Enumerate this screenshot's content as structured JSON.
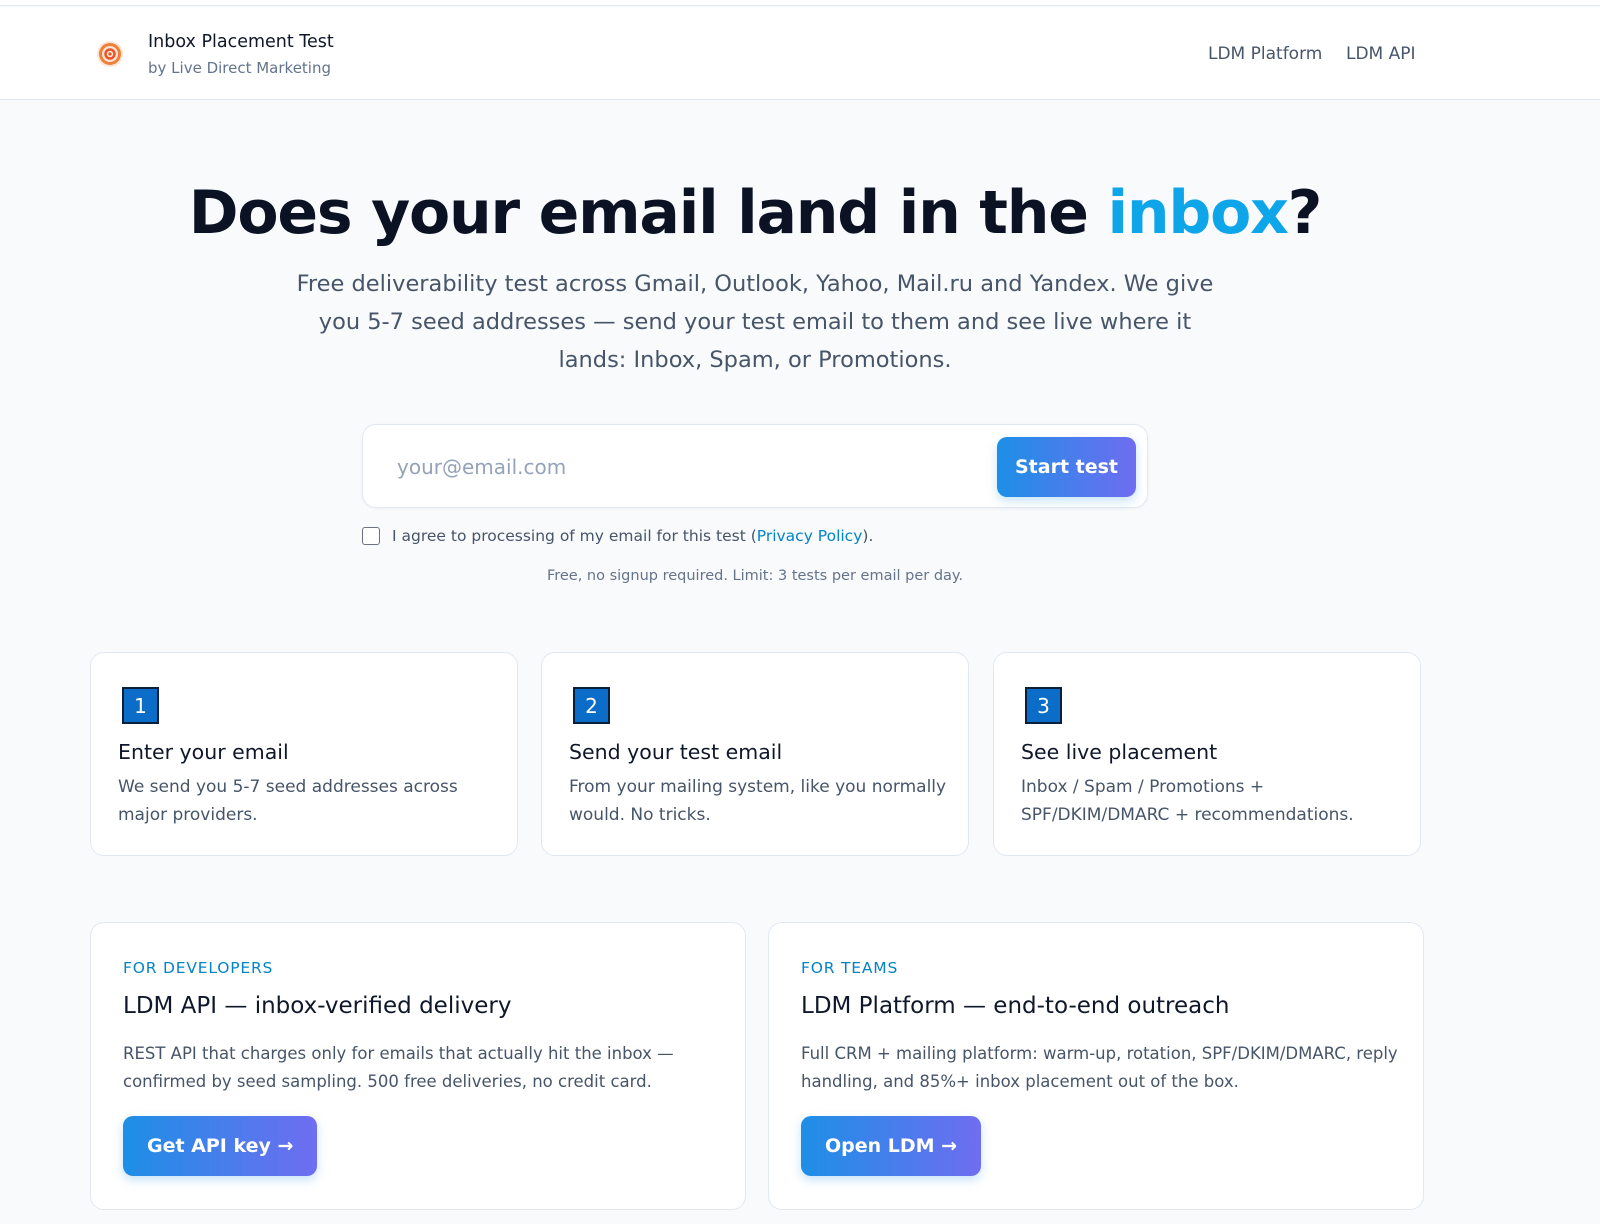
{
  "header": {
    "logo_icon": "target-icon",
    "title": "Inbox Placement Test",
    "subtitle": "by Live Direct Marketing",
    "nav": [
      {
        "label": "LDM Platform"
      },
      {
        "label": "LDM API"
      }
    ]
  },
  "hero": {
    "title_prefix": "Does your email land in the ",
    "title_accent": "inbox",
    "title_suffix": "?",
    "description": "Free deliverability test across Gmail, Outlook, Yahoo, Mail.ru and Yandex. We give you 5-7 seed addresses — send your test email to them and see live where it lands: Inbox, Spam, or Promotions."
  },
  "form": {
    "email_value": "",
    "email_placeholder": "your@email.com",
    "submit_label": "Start test",
    "consent_checked": false,
    "consent_prefix": "I agree to processing of my email for this test (",
    "consent_link": "Privacy Policy",
    "consent_suffix": ").",
    "note": "Free, no signup required. Limit: 3 tests per email per day."
  },
  "steps": [
    {
      "number": "1",
      "title": "Enter your email",
      "description": "We send you 5-7 seed addresses across major providers."
    },
    {
      "number": "2",
      "title": "Send your test email",
      "description": "From your mailing system, like you normally would. No tricks."
    },
    {
      "number": "3",
      "title": "See live placement",
      "description": "Inbox / Spam / Promotions + SPF/DKIM/DMARC + recommendations."
    }
  ],
  "promos": [
    {
      "eyebrow": "FOR DEVELOPERS",
      "title": "LDM API — inbox-verified delivery",
      "description": "REST API that charges only for emails that actually hit the inbox — confirmed by seed sampling. 500 free deliveries, no credit card.",
      "button": "Get API key →"
    },
    {
      "eyebrow": "FOR TEAMS",
      "title": "LDM Platform — end-to-end outreach",
      "description": "Full CRM + mailing platform: warm-up, rotation, SPF/DKIM/DMARC, reply handling, and 85%+ inbox placement out of the box.",
      "button": "Open LDM →"
    }
  ],
  "colors": {
    "accent": "#0ea5e9",
    "link": "#0284c7",
    "button_gradient_start": "#1d8fe6",
    "button_gradient_end": "#6f6df1",
    "step_badge": "#0b6dc8",
    "background": "#f8fafc"
  }
}
